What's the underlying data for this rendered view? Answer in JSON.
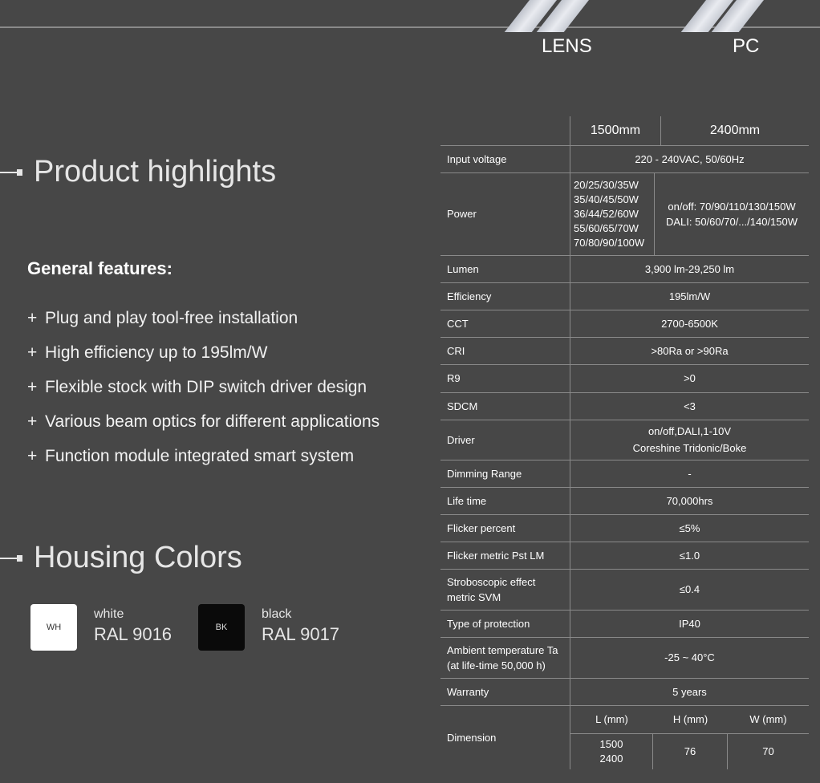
{
  "header": {
    "variant_lens": "LENS",
    "variant_pc": "PC"
  },
  "highlights": {
    "title": "Product highlights",
    "subheading": "General features:",
    "features": [
      "Plug and play tool-free installation",
      "High efficiency up to 195lm/W",
      "Flexible stock with DIP switch driver design",
      "Various beam optics for different applications",
      "Function module integrated smart system"
    ]
  },
  "housing": {
    "title": "Housing Colors",
    "colors": [
      {
        "badge": "WH",
        "name": "white",
        "code": "RAL 9016",
        "hex": "#ffffff"
      },
      {
        "badge": "BK",
        "name": "black",
        "code": "RAL 9017",
        "hex": "#0a0a0a"
      }
    ]
  },
  "spec": {
    "col_1500": "1500mm",
    "col_2400": "2400mm",
    "rows": {
      "input_voltage": {
        "label": "Input voltage",
        "value": "220 - 240VAC, 50/60Hz"
      },
      "power": {
        "label": "Power",
        "left": [
          "20/25/30/35W",
          "35/40/45/50W",
          "36/44/52/60W",
          "55/60/65/70W",
          "70/80/90/100W"
        ],
        "right": [
          "on/off: 70/90/110/130/150W",
          "DALI: 50/60/70/.../140/150W"
        ]
      },
      "lumen": {
        "label": "Lumen",
        "value": "3,900 lm-29,250 lm"
      },
      "efficiency": {
        "label": "Efficiency",
        "value": "195lm/W"
      },
      "cct": {
        "label": "CCT",
        "value": "2700-6500K"
      },
      "cri": {
        "label": "CRI",
        "value": ">80Ra or >90Ra"
      },
      "r9": {
        "label": "R9",
        "value": ">0"
      },
      "sdcm": {
        "label": "SDCM",
        "value": "<3"
      },
      "driver": {
        "label": "Driver",
        "line1": "on/off,DALI,1-10V",
        "line2": "Coreshine Tridonic/Boke"
      },
      "dimming": {
        "label": "Dimming Range",
        "value": "-"
      },
      "lifetime": {
        "label": "Life time",
        "value": "70,000hrs"
      },
      "flicker": {
        "label": "Flicker percent",
        "value": "≤5%"
      },
      "pst": {
        "label": "Flicker metric Pst LM",
        "value": "≤1.0"
      },
      "svm": {
        "label1": "Stroboscopic effect",
        "label2": "metric SVM",
        "value": "≤0.4"
      },
      "protection": {
        "label": "Type of protection",
        "value": "IP40"
      },
      "ambient": {
        "label1": "Ambient temperature Ta",
        "label2": "(at life-time 50,000 h)",
        "value": "-25 ~ 40°C"
      },
      "warranty": {
        "label": "Warranty",
        "value": "5 years"
      },
      "dimension": {
        "label": "Dimension",
        "head_l": "L (mm)",
        "head_h": "H (mm)",
        "head_w": "W (mm)",
        "l1": "1500",
        "l2": "2400",
        "h": "76",
        "w": "70"
      }
    }
  }
}
